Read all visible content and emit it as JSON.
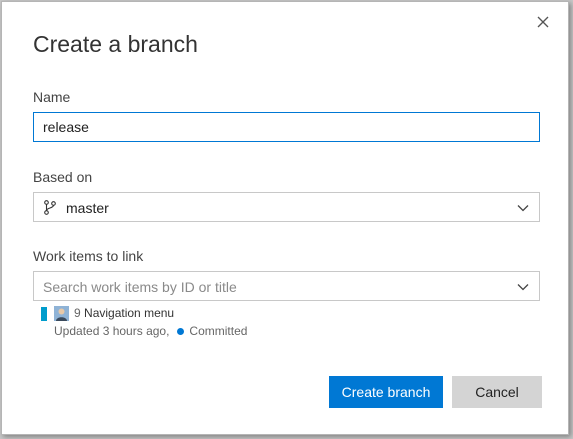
{
  "dialog": {
    "title": "Create a branch",
    "close_icon": "close-icon"
  },
  "name_field": {
    "label": "Name",
    "value": "release"
  },
  "based_on": {
    "label": "Based on",
    "selected": "master",
    "icon": "git-branch-icon"
  },
  "work_items": {
    "label": "Work items to link",
    "placeholder": "Search work items by ID or title",
    "linked": [
      {
        "id": "9",
        "title": "Navigation menu",
        "updated": "Updated 3 hours ago,",
        "state": "Committed",
        "type_color": "#009ccc",
        "state_color": "#0078d4"
      }
    ]
  },
  "buttons": {
    "create": "Create branch",
    "cancel": "Cancel"
  },
  "colors": {
    "accent": "#0078d4",
    "secondary_button": "#d4d4d4"
  }
}
